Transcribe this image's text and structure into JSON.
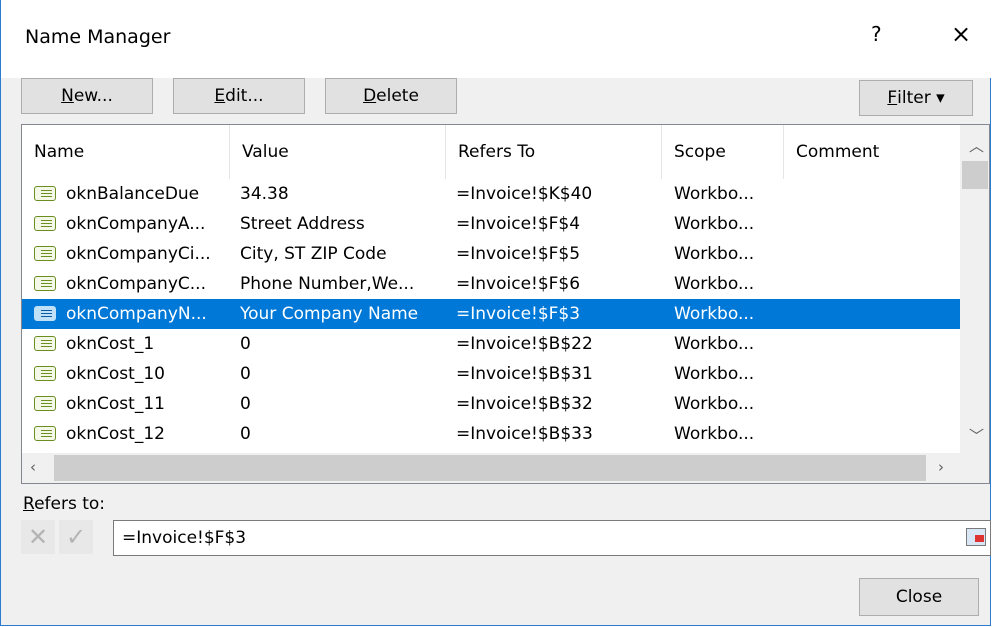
{
  "window": {
    "title": "Name Manager",
    "help": "?",
    "close": "×"
  },
  "toolbar": {
    "new_label": [
      "N",
      "ew..."
    ],
    "edit_label": [
      "E",
      "dit..."
    ],
    "delete_label": [
      "D",
      "elete"
    ],
    "filter_label": [
      "F",
      "ilter ▾"
    ]
  },
  "table": {
    "columns": [
      "Name",
      "Value",
      "Refers To",
      "Scope",
      "Comment"
    ],
    "rows": [
      {
        "name": "oknBalanceDue",
        "value": " 34.38",
        "refers": "=Invoice!$K$40",
        "scope": "Workbo...",
        "comment": ""
      },
      {
        "name": "oknCompanyA...",
        "value": "Street Address",
        "refers": "=Invoice!$F$4",
        "scope": "Workbo...",
        "comment": ""
      },
      {
        "name": "oknCompanyCi...",
        "value": "City, ST  ZIP Code",
        "refers": "=Invoice!$F$5",
        "scope": "Workbo...",
        "comment": ""
      },
      {
        "name": "oknCompanyC...",
        "value": "Phone Number,We...",
        "refers": "=Invoice!$F$6",
        "scope": "Workbo...",
        "comment": ""
      },
      {
        "name": "oknCompanyN...",
        "value": "Your Company Name",
        "refers": "=Invoice!$F$3",
        "scope": "Workbo...",
        "comment": "",
        "selected": true
      },
      {
        "name": "oknCost_1",
        "value": "0",
        "refers": "=Invoice!$B$22",
        "scope": "Workbo...",
        "comment": ""
      },
      {
        "name": "oknCost_10",
        "value": "0",
        "refers": "=Invoice!$B$31",
        "scope": "Workbo...",
        "comment": ""
      },
      {
        "name": "oknCost_11",
        "value": "0",
        "refers": "=Invoice!$B$32",
        "scope": "Workbo...",
        "comment": ""
      },
      {
        "name": "oknCost_12",
        "value": "0",
        "refers": "=Invoice!$B$33",
        "scope": "Workbo...",
        "comment": ""
      }
    ]
  },
  "refers": {
    "label": [
      "R",
      "efers to:"
    ],
    "value": "=Invoice!$F$3"
  },
  "footer": {
    "close_label": "Close"
  },
  "colors": {
    "selection": "#0078d7",
    "border": "#2b7bd3"
  }
}
